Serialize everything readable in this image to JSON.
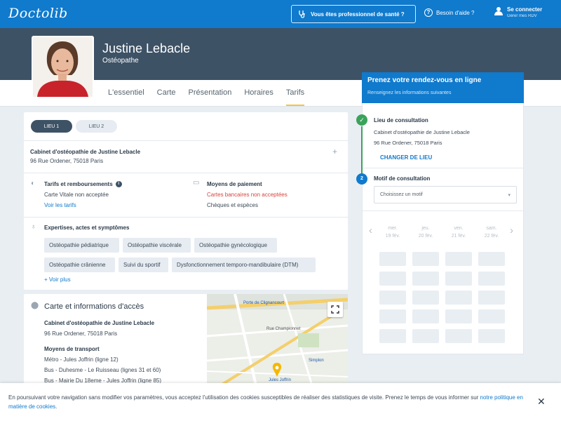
{
  "header": {
    "logo": "Doctolib",
    "pro_button": "Vous êtes professionnel de santé ?",
    "help": "Besoin d'aide ?",
    "login_title": "Se connecter",
    "login_sub": "Gérer mes RDV"
  },
  "profile": {
    "name": "Justine Lebacle",
    "specialty": "Ostéopathe",
    "tabs": [
      "L'essentiel",
      "Carte",
      "Présentation",
      "Horaires",
      "Tarifs"
    ],
    "active_tab": "Tarifs"
  },
  "locations": {
    "tabs": [
      "LIEU 1",
      "LIEU 2"
    ],
    "cabinet_name": "Cabinet d'ostéopathie de Justine Lebacle",
    "cabinet_address": "96 Rue Ordener, 75018 Paris"
  },
  "fees": {
    "title": "Tarifs et remboursements",
    "text": "Carte Vitale non acceptée",
    "link": "Voir les tarifs"
  },
  "payment": {
    "title": "Moyens de paiement",
    "warning": "Cartes bancaires non acceptées",
    "text": "Chèques et espèces"
  },
  "expertise": {
    "title": "Expertises, actes et symptômes",
    "chips": [
      "Ostéopathie pédiatrique",
      "Ostéopathie viscérale",
      "Ostéopathie gynécologique",
      "Ostéopathie crânienne",
      "Suivi du sportif",
      "Dysfonctionnement temporo-mandibulaire (DTM)"
    ],
    "see_more": "+ Voir plus"
  },
  "access": {
    "title": "Carte et informations d'accès",
    "cabinet_name": "Cabinet d'ostéopathie de Justine Lebacle",
    "cabinet_address": "96 Rue Ordener, 75018 Paris",
    "transport_title": "Moyens de transport",
    "transport": [
      "Métro - Jules Joffrin (ligne 12)",
      "Bus - Duhesme - Le Ruisseau (lignes 31 et 60)",
      "Bus - Mairie Du 18eme - Jules Joffrin (ligne 85)"
    ]
  },
  "map": {
    "labels": [
      "Porte de Clignancourt",
      "Rue Championnet",
      "Simplon",
      "Jules Joffrin"
    ]
  },
  "booking": {
    "title": "Prenez votre rendez-vous en ligne",
    "subtitle": "Renseignez les informations suivantes",
    "step1_label": "Lieu de consultation",
    "step1_name": "Cabinet d'ostéopathie de Justine Lebacle",
    "step1_address": "96 Rue Ordener, 75018 Paris",
    "step1_change": "CHANGER DE LIEU",
    "step2_number": "2",
    "step2_label": "Motif de consultation",
    "select_placeholder": "Choisissez un motif",
    "days": [
      {
        "name": "mer.",
        "date": "19 fév."
      },
      {
        "name": "jeu.",
        "date": "20 fév."
      },
      {
        "name": "ven.",
        "date": "21 fév."
      },
      {
        "name": "sam.",
        "date": "22 fév."
      }
    ]
  },
  "cookie": {
    "text": "En poursuivant votre navigation sans modifier vos paramètres, vous acceptez l'utilisation des cookies susceptibles de réaliser des statistiques de visite. Prenez le temps de vous informer sur ",
    "link": "notre politique en matière de cookies",
    "end": "."
  }
}
